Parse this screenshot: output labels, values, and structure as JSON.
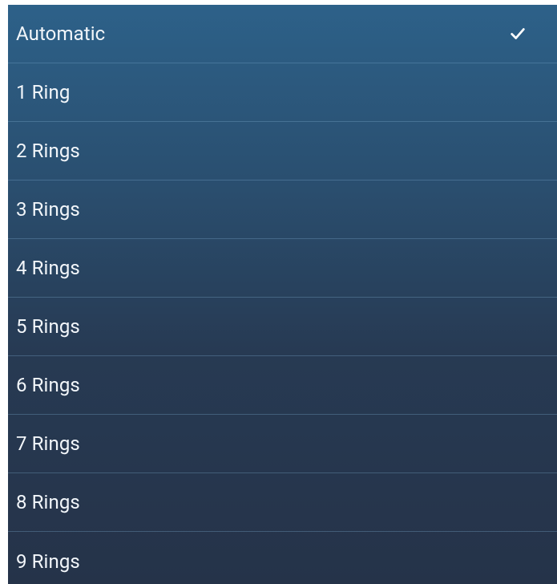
{
  "menu": {
    "selected_index": 0,
    "items": [
      {
        "label": "Automatic",
        "selected": true,
        "icon": "check-icon"
      },
      {
        "label": "1 Ring",
        "selected": false
      },
      {
        "label": "2 Rings",
        "selected": false
      },
      {
        "label": "3 Rings",
        "selected": false
      },
      {
        "label": "4 Rings",
        "selected": false
      },
      {
        "label": "5 Rings",
        "selected": false
      },
      {
        "label": "6 Rings",
        "selected": false
      },
      {
        "label": "7 Rings",
        "selected": false
      },
      {
        "label": "8 Rings",
        "selected": false
      },
      {
        "label": "9 Rings",
        "selected": false
      }
    ]
  },
  "colors": {
    "text": "#f2f6fa",
    "background_top": "#2d6189",
    "background_bottom": "#253349",
    "divider": "#5a86ab"
  }
}
